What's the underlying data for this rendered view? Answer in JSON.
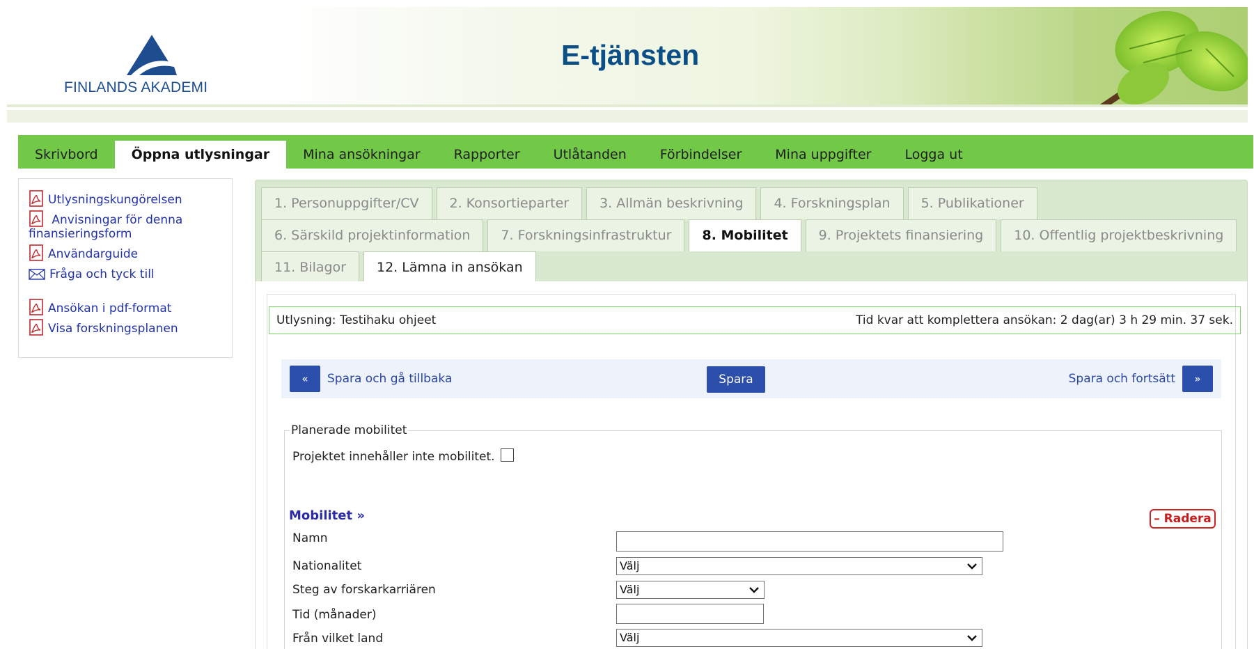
{
  "header": {
    "logo_text": "FINLANDS AKADEMI",
    "title": "E-tjänsten"
  },
  "topnav": [
    {
      "label": "Skrivbord",
      "active": false
    },
    {
      "label": "Öppna utlysningar",
      "active": true
    },
    {
      "label": "Mina ansökningar",
      "active": false
    },
    {
      "label": "Rapporter",
      "active": false
    },
    {
      "label": "Utlåtanden",
      "active": false
    },
    {
      "label": "Förbindelser",
      "active": false
    },
    {
      "label": "Mina uppgifter",
      "active": false
    },
    {
      "label": "Logga ut",
      "active": false
    }
  ],
  "sidebar": {
    "links": [
      {
        "label": "Utlysningskungörelsen",
        "icon": "pdf-icon"
      },
      {
        "label": "Anvisningar för denna finansieringsform",
        "icon": "pdf-icon"
      },
      {
        "label": "Användarguide",
        "icon": "pdf-icon"
      },
      {
        "label": "Fråga och tyck till",
        "icon": "mail-icon"
      },
      {
        "label": "Ansökan i pdf-format",
        "icon": "pdf-icon"
      },
      {
        "label": "Visa forskningsplanen",
        "icon": "pdf-icon"
      }
    ]
  },
  "tabs": {
    "row1": [
      "1. Personuppgifter/CV",
      "2. Konsortieparter",
      "3. Allmän beskrivning",
      "4. Forskningsplan",
      "5. Publikationer"
    ],
    "row2": [
      "6. Särskild projektinformation",
      "7. Forskningsinfrastruktur",
      "8. Mobilitet",
      "9. Projektets finansiering",
      "10. Offentlig projektbeskrivning"
    ],
    "row3": [
      "11. Bilagor",
      "12. Lämna in ansökan"
    ],
    "current": "8. Mobilitet"
  },
  "status": {
    "call": "Utlysning: Testihaku ohjeet",
    "time_left": "Tid kvar att komplettera ansökan: 2 dag(ar) 3 h 29 min. 37 sek."
  },
  "actions": {
    "back_icon": "«",
    "back_label": "Spara och gå tillbaka",
    "save_label": "Spara",
    "forward_label": "Spara och fortsätt",
    "forward_icon": "»"
  },
  "form": {
    "legend": "Planerade mobilitet",
    "no_mobility_label": "Projektet innehåller inte mobilitet.",
    "no_mobility_checked": false,
    "section_title": "Mobilitet »",
    "delete_label": "– Radera",
    "fields": {
      "name_label": "Namn",
      "name_value": "",
      "nationality_label": "Nationalitet",
      "nationality_value": "Välj",
      "career_label": "Steg av forskarkarriären",
      "career_value": "Välj",
      "duration_label": "Tid (månader)",
      "duration_value": "",
      "from_country_label": "Från vilket land",
      "from_country_value": "Välj"
    }
  },
  "colors": {
    "nav_green": "#72c947",
    "tab_bg": "#d9e9cf",
    "button_blue": "#2d4fac",
    "link_blue": "#2233aa",
    "delete_red": "#d12222",
    "title_blue": "#0b4f86"
  }
}
